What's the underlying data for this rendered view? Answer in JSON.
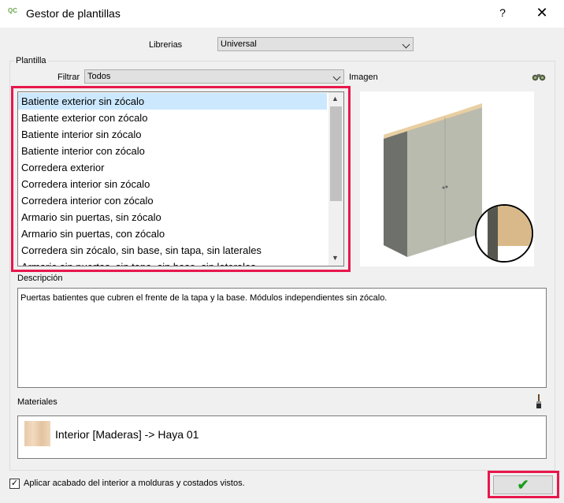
{
  "window": {
    "title": "Gestor de plantillas",
    "app_icon_text": "QC",
    "help_label": "?",
    "close_label": "✕"
  },
  "librerias": {
    "label": "Librerias",
    "value": "Universal"
  },
  "plantilla": {
    "group_label": "Plantilla",
    "filter_label": "Filtrar",
    "filter_value": "Todos",
    "image_label": "Imagen",
    "items": [
      "Batiente exterior sin zócalo",
      "Batiente exterior con zócalo",
      "Batiente interior sin zócalo",
      "Batiente interior con zócalo",
      "Corredera exterior",
      "Corredera interior sin zócalo",
      "Corredera interior con zócalo",
      "Armario sin puertas, sin zócalo",
      "Armario sin puertas, con zócalo",
      "Corredera sin zócalo, sin base, sin tapa, sin laterales",
      "Armario sin puertas, sin tapa, sin base, sin laterales"
    ],
    "selected_index": 0
  },
  "descripcion": {
    "label": "Descripción",
    "text": "Puertas batientes que cubren el frente de la tapa y la base. Módulos independientes sin zócalo."
  },
  "materiales": {
    "label": "Materiales",
    "item": "Interior [Maderas] -> Haya 01"
  },
  "apply_finish": {
    "label": "Aplicar acabado del interior a molduras y costados vistos.",
    "checked": true,
    "check_glyph": "✓"
  },
  "ok_button": {
    "glyph": "✔"
  },
  "colors": {
    "highlight": "#e8174b",
    "selection": "#cce8ff",
    "ok_green": "#1b9e1b"
  }
}
